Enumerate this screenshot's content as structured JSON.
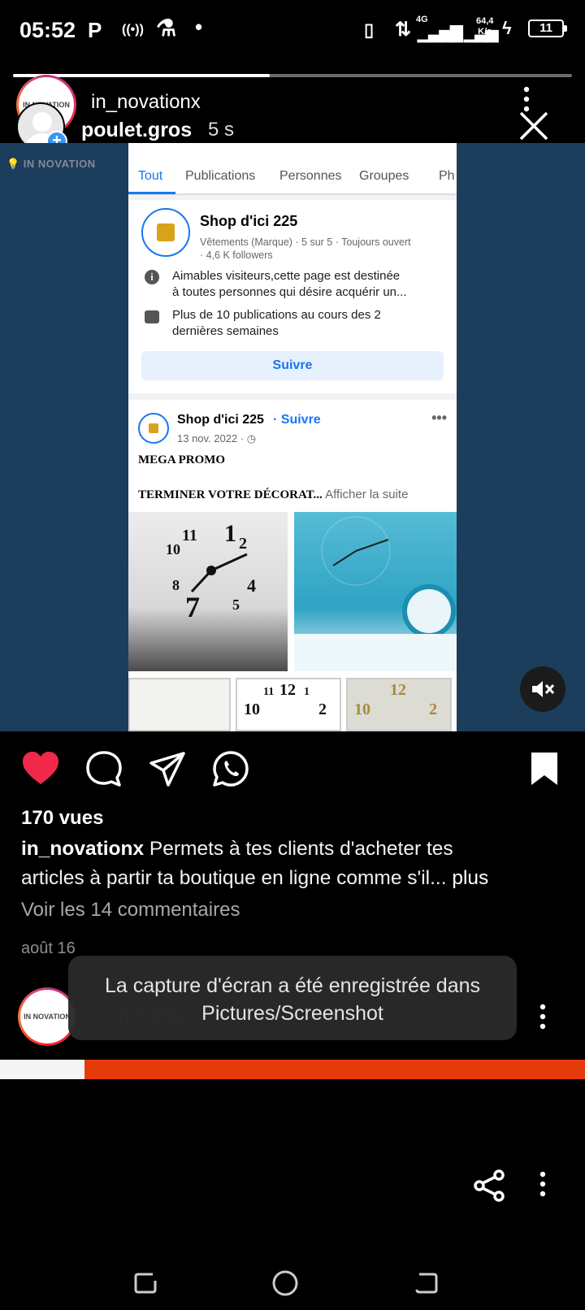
{
  "status_bar": {
    "time": "05:52",
    "network": "4G",
    "speed_value": "64,4",
    "speed_unit": "K/s",
    "battery": "11"
  },
  "story": {
    "progress": 0.46,
    "account": "in_novationx",
    "viewer_account": "poulet.gros",
    "elapsed": "5 s",
    "avatar_text": "IN NOVATION"
  },
  "facebook_screenshot": {
    "tabs": [
      "Tout",
      "Publications",
      "Personnes",
      "Groupes",
      "Ph"
    ],
    "page_name": "Shop d'ici 225",
    "page_meta_line1": "Vêtements (Marque) · 5 sur 5 · Toujours ouvert",
    "page_meta_line2": "· 4,6 K followers",
    "info_line1": "Aimables visiteurs,cette page est destinée",
    "info_line2": "à toutes personnes qui désire acquérir un...",
    "feed_line1": "Plus de 10 publications au cours des 2",
    "feed_line2": "dernières semaines",
    "follow_button": "Suivre",
    "post_author": "Shop d'ici 225",
    "post_follow": "· Suivre",
    "post_date": "13 nov. 2022 · ◷",
    "post_more": "•••",
    "post_line1": "MEGA PROMO",
    "post_line2_main": "TERMINER VOTRE DÉCORAT...",
    "post_line2_more": " Afficher la suite"
  },
  "actions": {
    "liked": true,
    "saved": true
  },
  "post": {
    "views": "170 vues",
    "author": "in_novationx",
    "caption_line1": " Permets à tes clients d'acheter tes",
    "caption_line2": "articles à partir ta boutique en ligne comme s'il...",
    "caption_more": " plus",
    "comments_link": "Voir les 14 commentaires",
    "date": "août 16"
  },
  "next_story": {
    "account": "in_novationx"
  },
  "toast": {
    "line1": "La capture d'écran a été enregistrée dans",
    "line2": "Pictures/Screenshot"
  },
  "colors": {
    "like": "#f02849",
    "accent": "#3897f0",
    "media_bg": "#1c3d5c",
    "strip_red": "#e63a0c"
  }
}
